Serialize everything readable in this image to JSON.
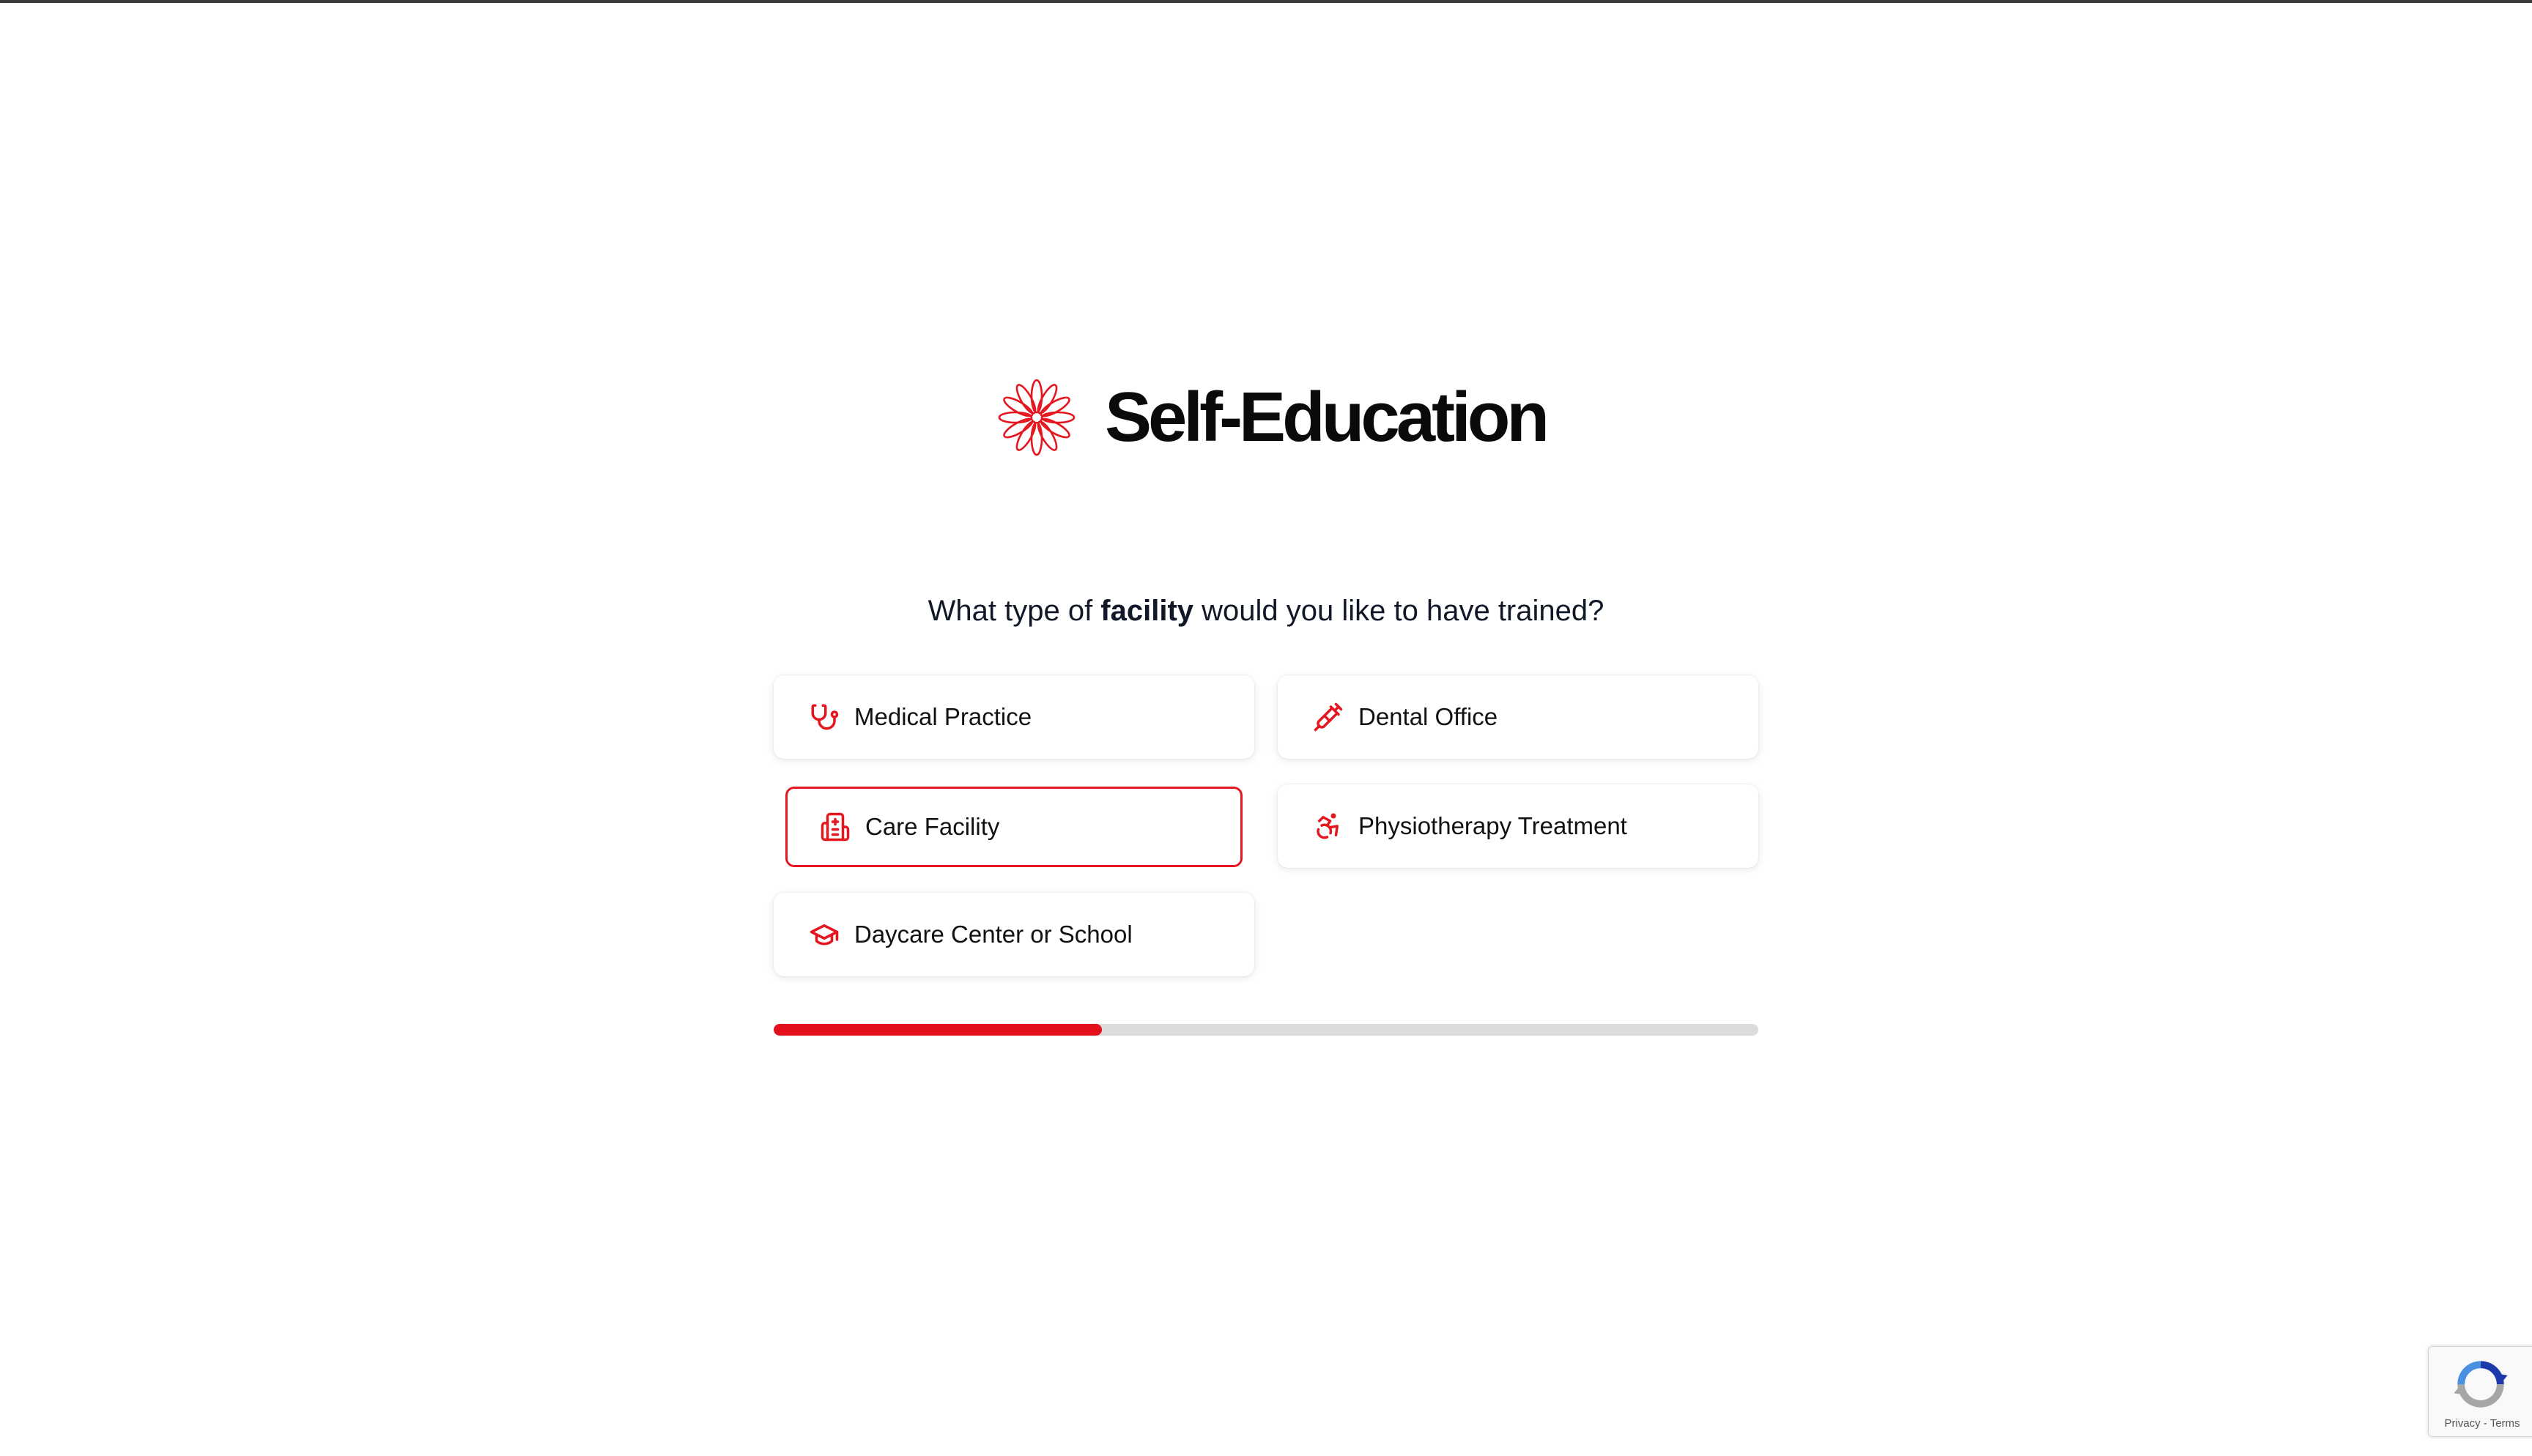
{
  "brand": {
    "title": "Self-Education",
    "logo_icon": "red-flower-icon",
    "accent_color": "#e4161f"
  },
  "question": {
    "prefix": "What type of ",
    "emphasis": "facility",
    "suffix": " would you like to have trained?"
  },
  "options": [
    {
      "label": "Medical Practice",
      "icon": "stethoscope-icon",
      "selected": false
    },
    {
      "label": "Dental Office",
      "icon": "syringe-icon",
      "selected": false
    },
    {
      "label": "Care Facility",
      "icon": "hospital-building-icon",
      "selected": true
    },
    {
      "label": "Physiotherapy Treatment",
      "icon": "accessibility-icon",
      "selected": false
    },
    {
      "label": "Daycare Center or School",
      "icon": "graduation-cap-icon",
      "selected": false
    }
  ],
  "progress": {
    "fraction": 0.333,
    "fill_color": "#e4101c",
    "track_color": "#dcdcdc"
  },
  "recaptcha": {
    "icon": "recaptcha-icon",
    "privacy": "Privacy",
    "separator": " - ",
    "terms": "Terms"
  }
}
